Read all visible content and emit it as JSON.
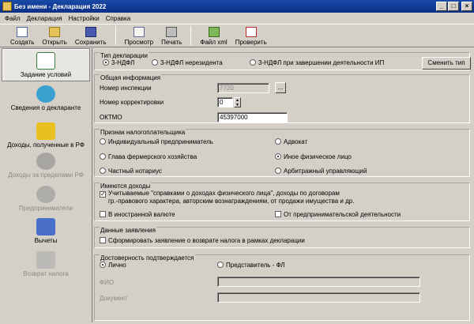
{
  "window": {
    "title": "Без имени - Декларация 2022"
  },
  "menu": [
    "Файл",
    "Декларация",
    "Настройки",
    "Справка"
  ],
  "toolbar": {
    "create": "Создать",
    "open": "Открыть",
    "save": "Сохранить",
    "preview": "Просмотр",
    "print": "Печать",
    "xml": "Файл xml",
    "check": "Проверить"
  },
  "sidebar": {
    "items": [
      {
        "label": "Задание условий",
        "icon": "conditions-icon"
      },
      {
        "label": "Сведения о декларанте",
        "icon": "declarant-icon"
      },
      {
        "label": "Доходы, полученные в РФ",
        "icon": "coins-icon"
      },
      {
        "label": "Доходы за пределами РФ",
        "icon": "money-bag-icon"
      },
      {
        "label": "Предприниматели",
        "icon": "gears-icon"
      },
      {
        "label": "Вычеты",
        "icon": "deductions-icon"
      },
      {
        "label": "Возврат налога",
        "icon": "tax-return-icon"
      }
    ]
  },
  "declaration_type": {
    "title": "Тип декларации",
    "options": [
      "3-НДФЛ",
      "3-НДФЛ нерезидента",
      "3-НДФЛ при завершении деятельности ИП"
    ],
    "selected": "3-НДФЛ",
    "change_button": "Сменить тип"
  },
  "general": {
    "title": "Общая информация",
    "inspection_label": "Номер инспекции",
    "inspection_value": "7720",
    "browse_button": "...",
    "correction_label": "Номер корректировки",
    "correction_value": "0",
    "oktmo_label": "ОКТМО",
    "oktmo_value": "45397000"
  },
  "taxpayer": {
    "title": "Признак налогоплательщика",
    "options": [
      "Индивидуальный предприниматель",
      "Адвокат",
      "Глава фермерского хозяйства",
      "Иное физическое лицо",
      "Частный нотариус",
      "Арбитражный управляющий"
    ],
    "selected": "Иное физическое лицо"
  },
  "income": {
    "title": "Имеются доходы",
    "certificates_line1": "Учитываемые \"справками о доходах физического лица\", доходы по договорам",
    "certificates_line2": "гр.-правового характера, авторским вознаграждениям, от продажи имущества и др.",
    "certificates_checked": true,
    "foreign_currency": "В иностранной валюте",
    "business": "От предпринимательской деятельности"
  },
  "statements": {
    "title": "Данные заявления",
    "refund_label": "Сформировать заявление о возврате налога в рамках декларации"
  },
  "authenticity": {
    "title": "Достоверность подтверждается",
    "personal": "Лично",
    "representative": "Представитель - ФЛ",
    "selected": "Лично",
    "fio_label": "ФИО",
    "document_label": "Документ"
  }
}
